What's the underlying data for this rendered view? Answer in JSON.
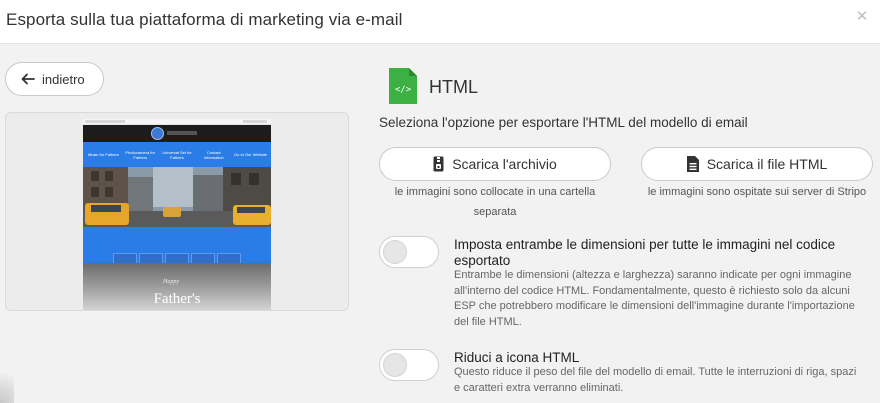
{
  "dialog": {
    "title": "Esporta sulla tua piattaforma di marketing via e-mail",
    "close_icon": "close-icon"
  },
  "back": {
    "label": "indietro",
    "icon": "arrow-left-icon"
  },
  "preview": {
    "nav_items": [
      "Music for Fathers",
      "Photocamera for Fathers",
      "Universal Set for Fathers",
      "Contact Information",
      "Go to Our Website"
    ],
    "script_text": "Happy",
    "hero_text": "Father's"
  },
  "format": {
    "icon": "html-file-icon",
    "icon_label": "</>",
    "title": "HTML",
    "accent": "#3cb043"
  },
  "instructions": "Seleziona l'opzione per esportare l'HTML del modello di email",
  "downloads": [
    {
      "label": "Scarica l'archivio",
      "icon": "zip-archive-icon",
      "note": "le immagini sono collocate in una cartella separata"
    },
    {
      "label": "Scarica il file HTML",
      "icon": "document-icon",
      "note": "le immagini sono ospitate sui server di Stripo"
    }
  ],
  "options": [
    {
      "title": "Imposta entrambe le dimensioni per tutte le immagini nel codice esportato",
      "description": "Entrambe le dimensioni (altezza e larghezza) saranno indicate per ogni immagine all'interno del codice HTML. Fondamentalmente, questo è richiesto solo da alcuni ESP che potrebbero modificare le dimensioni dell'immagine durante l'importazione del file HTML.",
      "enabled": false
    },
    {
      "title": "Riduci a icona HTML",
      "description": "Questo riduce il peso del file del modello di email. Tutte le interruzioni di riga, spazi e caratteri extra verranno eliminati.",
      "enabled": false
    }
  ]
}
